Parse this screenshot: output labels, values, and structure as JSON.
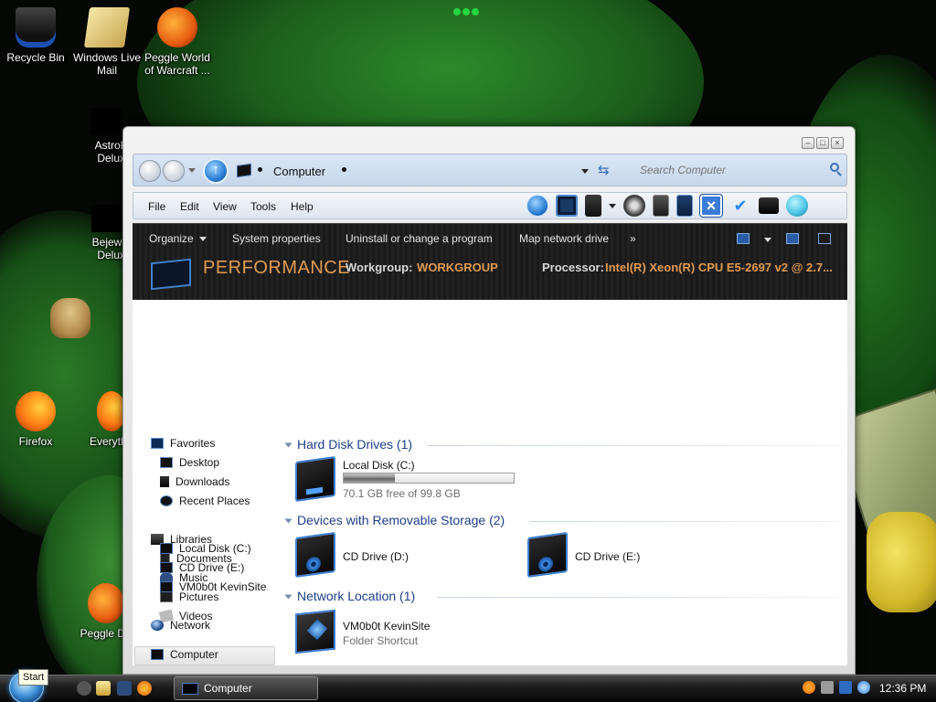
{
  "desktop": {
    "icons": [
      {
        "label": "Recycle Bin",
        "icon": "recycle-bin-icon"
      },
      {
        "label": "Windows Live\nMail",
        "icon": "windows-live-mail-icon"
      },
      {
        "label": "Peggle World\nof Warcraft ...",
        "icon": "peggle-icon"
      },
      {
        "label": "AstroPo\nDeluxe",
        "icon": "astropop-icon"
      },
      {
        "label": "Bejewele\nDeluxe",
        "icon": "bejeweled-icon"
      },
      {
        "label": "Firefox",
        "icon": "firefox-icon"
      },
      {
        "label": "Everythin",
        "icon": "everything-icon"
      },
      {
        "label": "Peggle Del",
        "icon": "peggle-deluxe-icon"
      }
    ]
  },
  "window": {
    "title_path": "Computer",
    "search_placeholder": "Search Computer",
    "controls": [
      "minimize",
      "maximize",
      "close"
    ],
    "menu": [
      "File",
      "Edit",
      "View",
      "Tools",
      "Help"
    ],
    "command_bar": {
      "organize": "Organize",
      "system_properties": "System properties",
      "uninstall": "Uninstall or change a program",
      "map_drive": "Map network drive",
      "more": "»"
    },
    "details": {
      "heading": "PERFORMANCE",
      "workgroup_label": "Workgroup:",
      "workgroup_value": "WORKGROUP",
      "processor_label": "Processor:",
      "processor_value": "Intel(R) Xeon(R) CPU E5-2697 v2 @ 2.7..."
    },
    "nav": {
      "favorites": "Favorites",
      "desktop": "Desktop",
      "downloads": "Downloads",
      "recent": "Recent Places",
      "libraries": "Libraries",
      "documents": "Documents",
      "music": "Music",
      "pictures": "Pictures",
      "videos": "Videos",
      "computer": "Computer",
      "local_disk": "Local Disk (C:)",
      "cd_drive": "CD Drive (E:)",
      "site": "VM0b0t KevinSite",
      "network": "Network"
    },
    "groups": {
      "hdd": "Hard Disk Drives (1)",
      "removable": "Devices with Removable Storage (2)",
      "network": "Network Location (1)"
    },
    "items": {
      "local_disk": {
        "name": "Local Disk (C:)",
        "free": "70.1 GB free of 99.8 GB",
        "used_fraction": 0.3
      },
      "cd_d": {
        "name": "CD Drive (D:)"
      },
      "cd_e": {
        "name": "CD Drive (E:)"
      },
      "site": {
        "name": "VM0b0t KevinSite",
        "type": "Folder Shortcut"
      }
    }
  },
  "taskbar": {
    "start_tooltip": "Start",
    "task_label": "Computer",
    "clock": "12:36 PM"
  },
  "colors": {
    "accent": "#e09a52",
    "group_header": "#1e3e8a",
    "taskbar": "#0a0a0a"
  }
}
